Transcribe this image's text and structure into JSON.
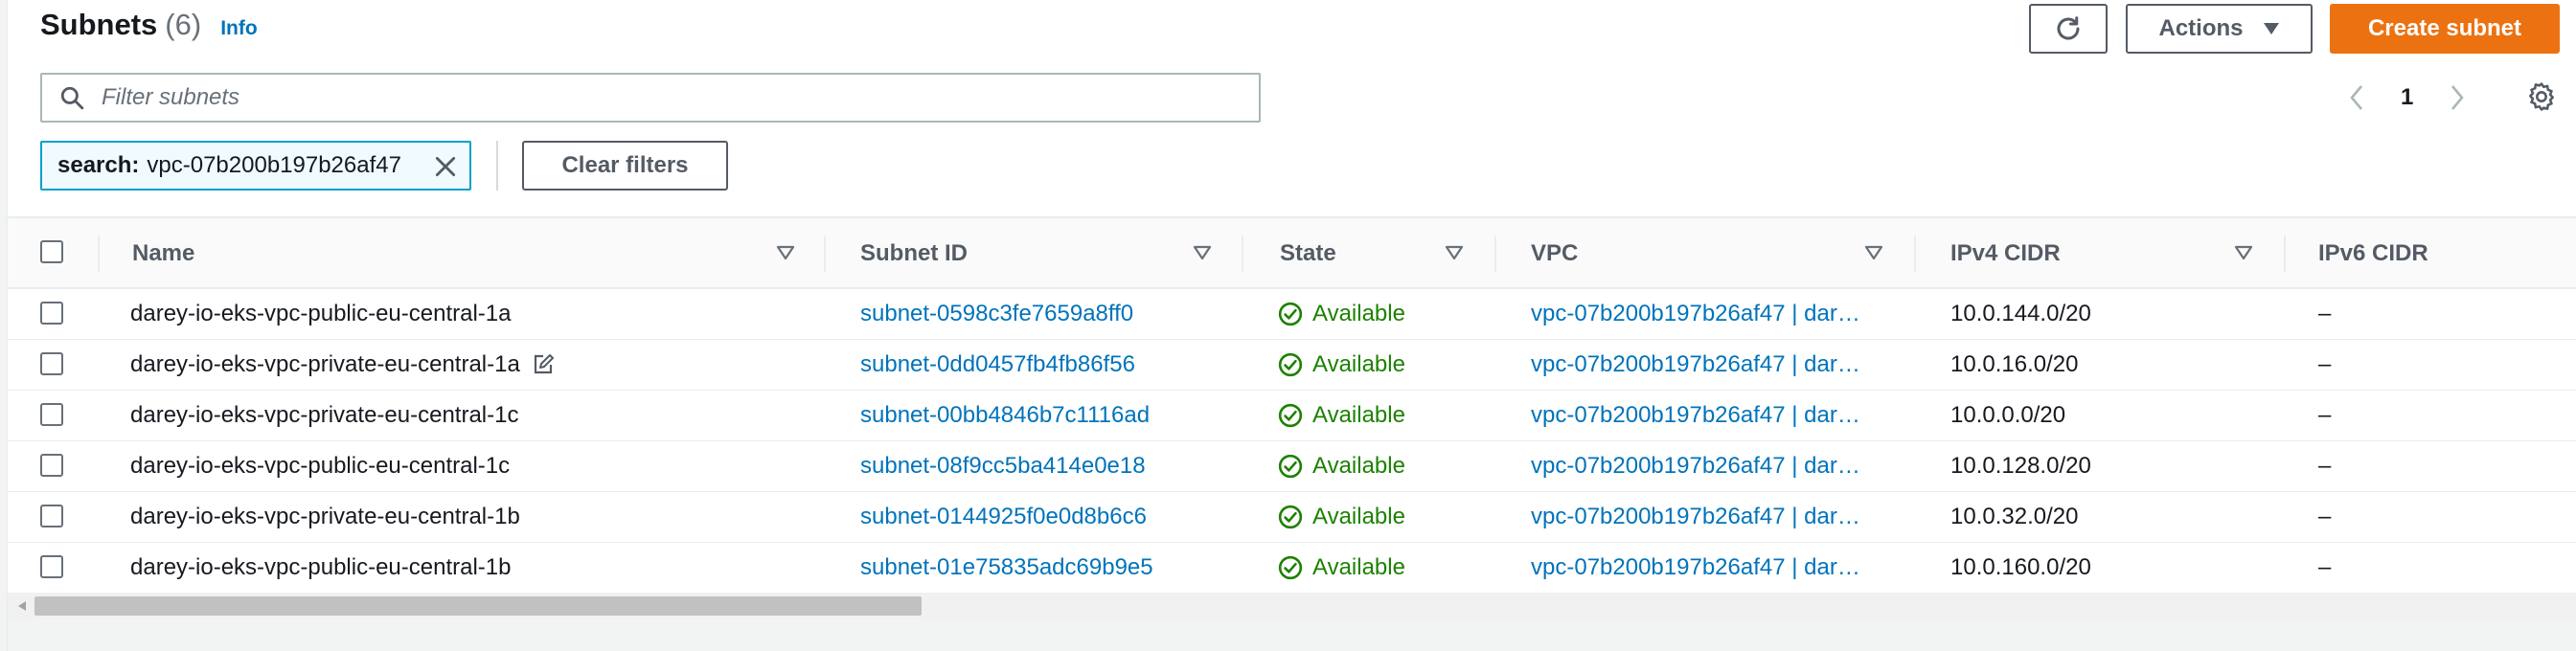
{
  "header": {
    "title": "Subnets",
    "count": "(6)",
    "info": "Info"
  },
  "toolbar": {
    "actions_label": "Actions",
    "create_label": "Create subnet"
  },
  "filter": {
    "placeholder": "Filter subnets"
  },
  "pagination": {
    "current_page": "1"
  },
  "token": {
    "key": "search:",
    "value": "vpc-07b200b197b26af47"
  },
  "clear_filters_label": "Clear filters",
  "columns": [
    "Name",
    "Subnet ID",
    "State",
    "VPC",
    "IPv4 CIDR",
    "IPv6 CIDR"
  ],
  "rows": [
    {
      "name": "darey-io-eks-vpc-public-eu-central-1a",
      "subnet_id": "subnet-0598c3fe7659a8ff0",
      "state": "Available",
      "vpc": "vpc-07b200b197b26af47 | dar…",
      "ipv4": "10.0.144.0/20",
      "ipv6": "–"
    },
    {
      "name": "darey-io-eks-vpc-private-eu-central-1a",
      "subnet_id": "subnet-0dd0457fb4fb86f56",
      "state": "Available",
      "vpc": "vpc-07b200b197b26af47 | dar…",
      "ipv4": "10.0.16.0/20",
      "ipv6": "–"
    },
    {
      "name": "darey-io-eks-vpc-private-eu-central-1c",
      "subnet_id": "subnet-00bb4846b7c1116ad",
      "state": "Available",
      "vpc": "vpc-07b200b197b26af47 | dar…",
      "ipv4": "10.0.0.0/20",
      "ipv6": "–"
    },
    {
      "name": "darey-io-eks-vpc-public-eu-central-1c",
      "subnet_id": "subnet-08f9cc5ba414e0e18",
      "state": "Available",
      "vpc": "vpc-07b200b197b26af47 | dar…",
      "ipv4": "10.0.128.0/20",
      "ipv6": "–"
    },
    {
      "name": "darey-io-eks-vpc-private-eu-central-1b",
      "subnet_id": "subnet-0144925f0e0d8b6c6",
      "state": "Available",
      "vpc": "vpc-07b200b197b26af47 | dar…",
      "ipv4": "10.0.32.0/20",
      "ipv6": "–"
    },
    {
      "name": "darey-io-eks-vpc-public-eu-central-1b",
      "subnet_id": "subnet-01e75835adc69b9e5",
      "state": "Available",
      "vpc": "vpc-07b200b197b26af47 | dar…",
      "ipv4": "10.0.160.0/20",
      "ipv6": "–"
    }
  ],
  "icons": {
    "refresh": "refresh-icon",
    "caret": "caret-down-icon",
    "search": "search-icon",
    "close": "close-icon",
    "settings": "gear-icon",
    "status": "check-circle-icon",
    "edit": "edit-icon"
  },
  "colors": {
    "primary": "#ec7211",
    "link": "#0073bb",
    "success": "#1d8102",
    "token_border": "#00a1c9"
  }
}
